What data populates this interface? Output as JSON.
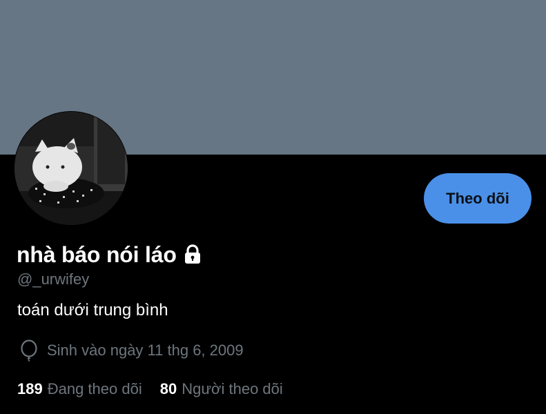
{
  "profile": {
    "display_name": "nhà báo nói láo",
    "handle": "@_urwifey",
    "bio": "toán dưới trung bình",
    "birth_date": "Sinh vào ngày 11 thg 6, 2009",
    "locked": true
  },
  "actions": {
    "follow_label": "Theo dõi"
  },
  "stats": {
    "following_count": "189",
    "following_label": "Đang theo dõi",
    "followers_count": "80",
    "followers_label": "Người theo dõi"
  },
  "colors": {
    "banner": "#677685",
    "background": "#000000",
    "follow_button": "#4a90e8",
    "secondary_text": "#6e767d"
  },
  "icons": {
    "lock": "lock-icon",
    "birthday": "balloon-icon"
  }
}
